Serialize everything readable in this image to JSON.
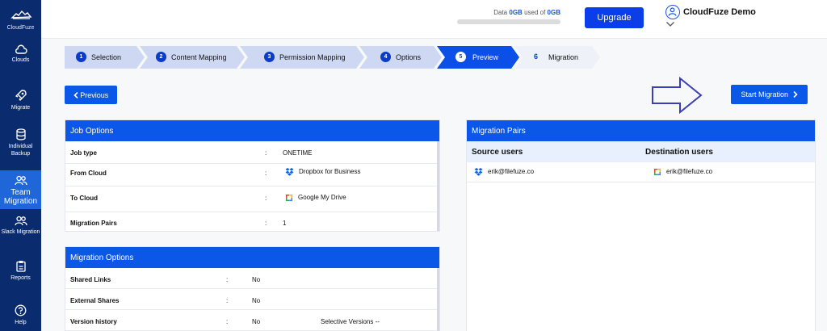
{
  "brand": {
    "name": "CloudFuze"
  },
  "sidebar": {
    "items": [
      {
        "label": "Clouds",
        "icon": "cloud-icon"
      },
      {
        "label": "Migrate",
        "icon": "rocket-icon"
      },
      {
        "label": "Individual Backup",
        "icon": "database-icon"
      },
      {
        "label": "Team Migration",
        "icon": "team-icon",
        "active": true
      },
      {
        "label": "Slack Migration",
        "icon": "slack-team-icon"
      },
      {
        "label": "Reports",
        "icon": "clipboard-icon"
      },
      {
        "label": "Help",
        "icon": "help-icon"
      }
    ]
  },
  "header": {
    "data_prefix": "Data",
    "data_used": "0GB",
    "data_mid": "used of",
    "data_total": "0GB",
    "usage_fraction": 0,
    "upgrade_label": "Upgrade",
    "user_name": "CloudFuze Demo"
  },
  "steps": [
    {
      "num": "1",
      "label": "Selection"
    },
    {
      "num": "2",
      "label": "Content Mapping"
    },
    {
      "num": "3",
      "label": "Permission Mapping"
    },
    {
      "num": "4",
      "label": "Options"
    },
    {
      "num": "5",
      "label": "Preview",
      "active": true
    },
    {
      "num": "6",
      "label": "Migration",
      "pending": true
    }
  ],
  "actions": {
    "previous_label": "Previous",
    "start_label": "Start Migration"
  },
  "job_options": {
    "title": "Job Options",
    "rows": [
      {
        "key": "Job type",
        "value": "ONETIME"
      },
      {
        "key": "From Cloud",
        "value": "Dropbox for Business",
        "icon": "dropbox-icon"
      },
      {
        "key": "To Cloud",
        "value": "Google My Drive",
        "icon": "google-drive-icon"
      },
      {
        "key": "Migration Pairs",
        "value": "1"
      }
    ]
  },
  "migration_options": {
    "title": "Migration Options",
    "rows": [
      {
        "key": "Shared Links",
        "value": "No"
      },
      {
        "key": "External Shares",
        "value": "No"
      },
      {
        "key": "Version history",
        "value": "No",
        "extra": "Selective Versions --"
      }
    ]
  },
  "migration_pairs": {
    "title": "Migration Pairs",
    "source_header": "Source users",
    "dest_header": "Destination users",
    "rows": [
      {
        "source": "erik@filefuze.co",
        "destination": "erik@filefuze.co"
      }
    ]
  },
  "colors": {
    "sidebar": "#0a2b6e",
    "accent": "#0b57e8",
    "active_step": "#0b4ee8",
    "step": "#cfd8f3"
  }
}
